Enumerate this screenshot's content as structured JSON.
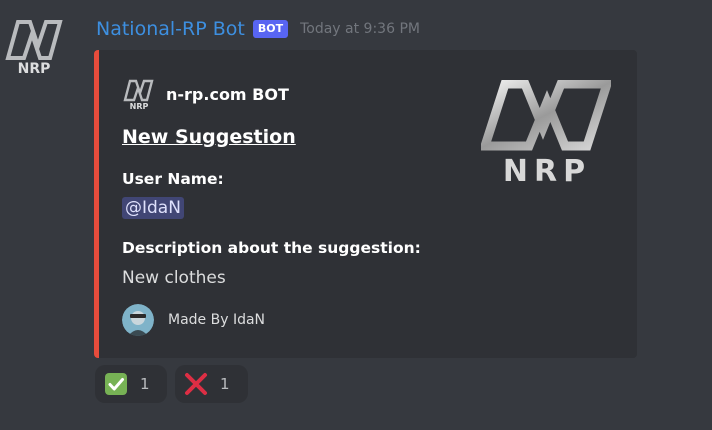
{
  "message": {
    "author": "National-RP Bot",
    "bot_tag": "BOT",
    "timestamp": "Today at 9:36 PM",
    "avatar_logo_text": "NRP"
  },
  "embed": {
    "accent_color": "#e74c3c",
    "author_name": "n-rp.com BOT",
    "title": "New Suggestion",
    "thumbnail_logo_text": "NRP",
    "fields": [
      {
        "name": "User Name:",
        "value": "@IdaN",
        "is_mention": true
      },
      {
        "name": "Description about the suggestion:",
        "value": "New clothes"
      }
    ],
    "footer_text": "Made By IdaN"
  },
  "reactions": [
    {
      "emoji": "white-check-mark",
      "count": "1"
    },
    {
      "emoji": "cross-mark",
      "count": "1"
    }
  ],
  "colors": {
    "background": "#36393f",
    "embed_background": "#2f3136",
    "author": "#3d8fe0",
    "bot_tag": "#5865f2",
    "mention_bg": "#414675"
  }
}
